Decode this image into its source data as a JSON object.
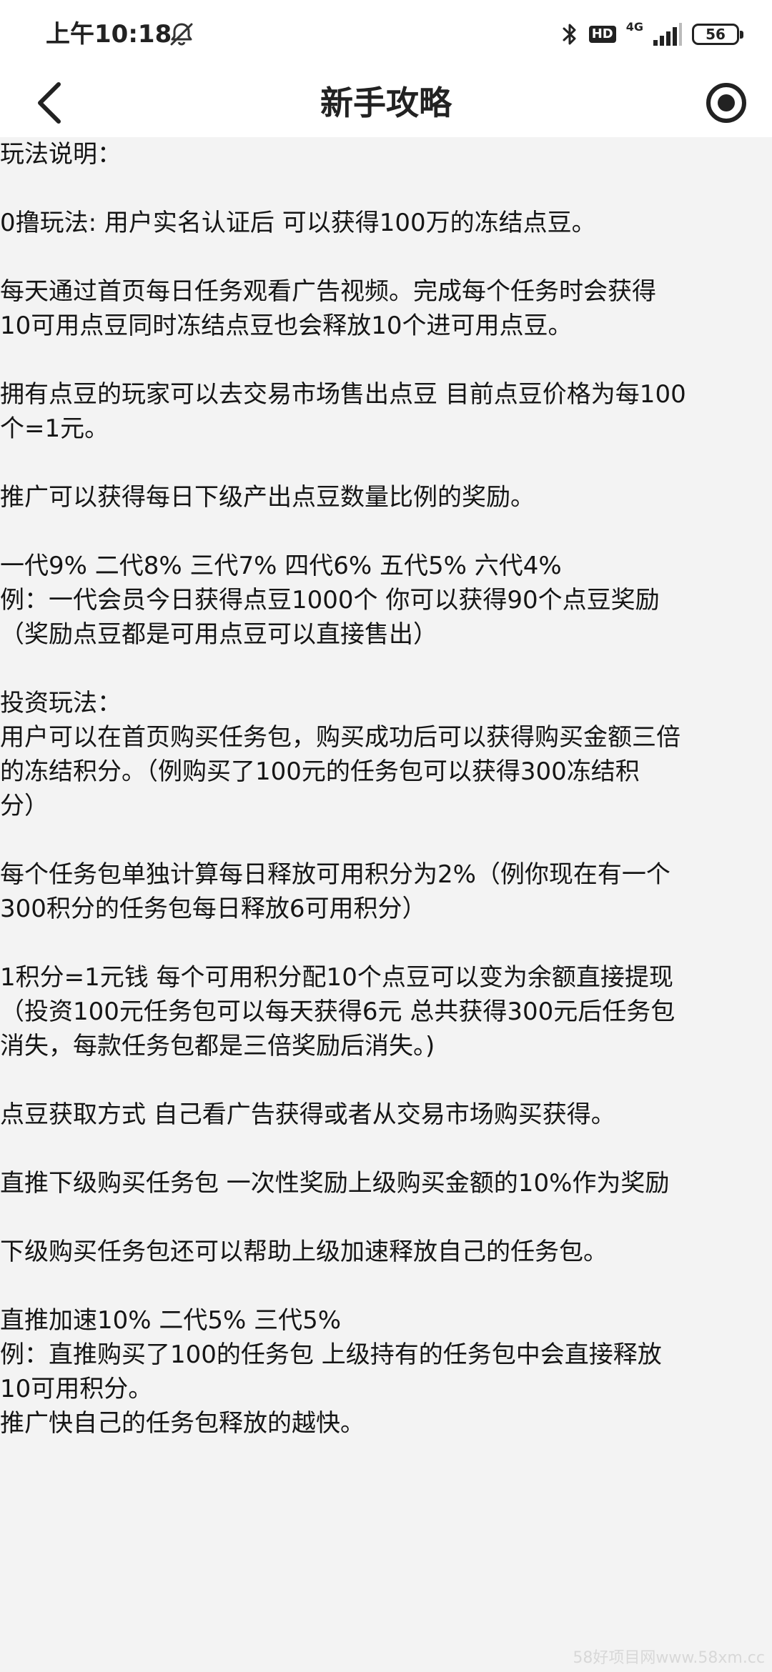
{
  "status_bar": {
    "time": "上午10:18",
    "hd": "HD",
    "network": "4G",
    "battery": "56"
  },
  "nav": {
    "title": "新手攻略"
  },
  "content": {
    "paragraphs": [
      [
        "玩法说明："
      ],
      [
        "0撸玩法: 用户实名认证后 可以获得100万的冻结点豆。"
      ],
      [
        "每天通过首页每日任务观看广告视频。完成每个任务时会获得",
        "10可用点豆同时冻结点豆也会释放10个进可用点豆。"
      ],
      [
        "拥有点豆的玩家可以去交易市场售出点豆 目前点豆价格为每100",
        "个=1元。"
      ],
      [
        "推广可以获得每日下级产出点豆数量比例的奖励。"
      ],
      [
        "一代9% 二代8% 三代7% 四代6% 五代5% 六代4%",
        "例：一代会员今日获得点豆1000个 你可以获得90个点豆奖励",
        "（奖励点豆都是可用点豆可以直接售出）"
      ],
      [
        "投资玩法：",
        "用户可以在首页购买任务包，购买成功后可以获得购买金额三倍",
        "的冻结积分。（例购买了100元的任务包可以获得300冻结积",
        "分）"
      ],
      [
        "每个任务包单独计算每日释放可用积分为2%（例你现在有一个",
        "300积分的任务包每日释放6可用积分）"
      ],
      [
        "1积分=1元钱  每个可用积分配10个点豆可以变为余额直接提现",
        "（投资100元任务包可以每天获得6元 总共获得300元后任务包",
        "消失，每款任务包都是三倍奖励后消失。)"
      ],
      [
        "点豆获取方式 自己看广告获得或者从交易市场购买获得。"
      ],
      [
        "直推下级购买任务包 一次性奖励上级购买金额的10%作为奖励"
      ],
      [
        "下级购买任务包还可以帮助上级加速释放自己的任务包。"
      ],
      [
        "直推加速10%  二代5%  三代5%",
        "例：直推购买了100的任务包  上级持有的任务包中会直接释放",
        "10可用积分。",
        "推广快自己的任务包释放的越快。"
      ]
    ]
  },
  "watermark": "58好项目网www.58xm.cc"
}
